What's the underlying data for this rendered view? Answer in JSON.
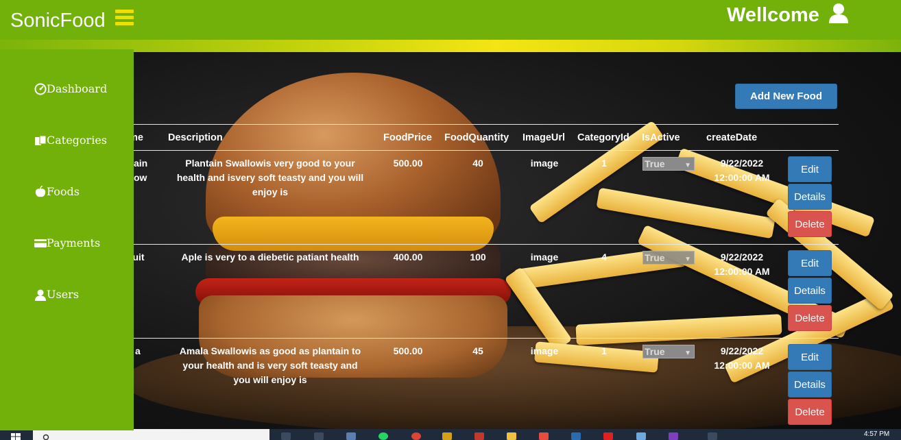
{
  "app": {
    "brand": "SonicFood",
    "welcome": "Wellcome"
  },
  "sidebar": {
    "items": [
      {
        "label": "Dashboard",
        "icon": "dashboard-icon"
      },
      {
        "label": "Categories",
        "icon": "categories-icon"
      },
      {
        "label": "Foods",
        "icon": "apple-icon"
      },
      {
        "label": "Payments",
        "icon": "credit-card-icon"
      },
      {
        "label": "Users",
        "icon": "user-icon"
      }
    ]
  },
  "toolbar": {
    "add_label": "Add New Food"
  },
  "table": {
    "headers": [
      "me",
      "Description",
      "FoodPrice",
      "FoodQuantity",
      "ImageUrl",
      "CategoryId",
      "IsActive",
      "createDate"
    ],
    "rows": [
      {
        "name_line1": "ain",
        "name_line2": "ow",
        "desc_line1": "Plantain Swallowis very good to your",
        "desc_line2": "health and isvery soft teasty and you will",
        "desc_line3": "enjoy is",
        "price": "500.00",
        "qty": "40",
        "image": "image",
        "category": "1",
        "active": "True",
        "date1": "9/22/2022",
        "date2": "12:00:00 AM"
      },
      {
        "name_line1": "ruit",
        "name_line2": "",
        "desc_line1": "Aple is very to a diebetic patiant health",
        "desc_line2": "",
        "desc_line3": "",
        "price": "400.00",
        "qty": "100",
        "image": "image",
        "category": "4",
        "active": "True",
        "date1": "9/22/2022",
        "date2": "12:00:00 AM"
      },
      {
        "name_line1": "a",
        "name_line2": "",
        "desc_line1": "Amala Swallowis as good as plantain to",
        "desc_line2": "your health and is very soft teasty and",
        "desc_line3": "you will enjoy is",
        "price": "500.00",
        "qty": "45",
        "image": "image",
        "category": "1",
        "active": "True",
        "date1": "9/22/2022",
        "date2": "12:00:00 AM"
      }
    ],
    "actions": {
      "edit": "Edit",
      "details": "Details",
      "delete": "Delete"
    }
  },
  "taskbar": {
    "time": "4:57 PM"
  },
  "colors": {
    "brand_green": "#72b00a",
    "primary_blue": "#337ab7",
    "danger_red": "#d9534f",
    "accent_yellow": "#f0e000"
  }
}
